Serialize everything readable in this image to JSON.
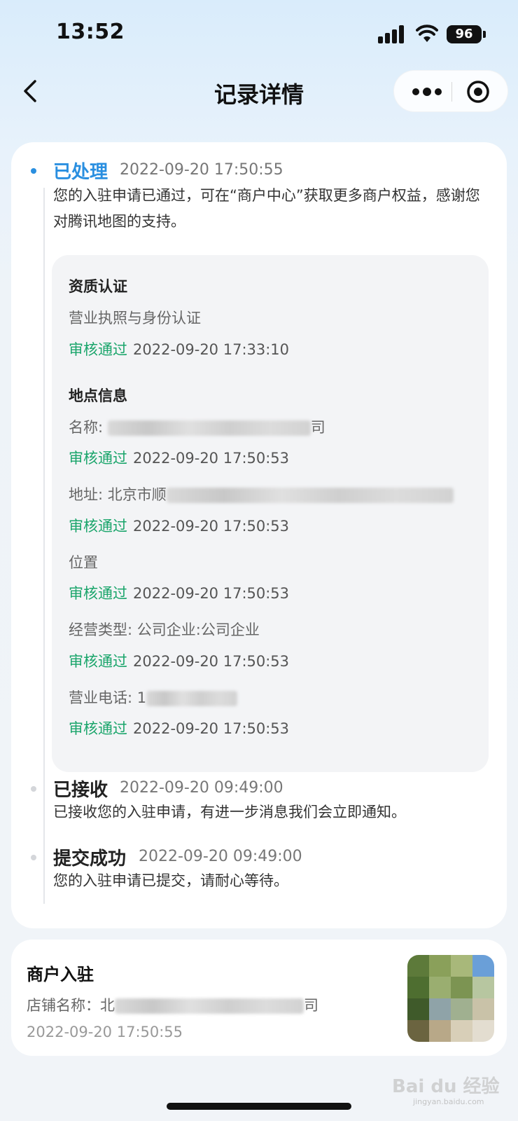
{
  "status_bar": {
    "time": "13:52",
    "battery": "96",
    "icons": [
      "signal-icon",
      "wifi-icon",
      "battery-icon"
    ]
  },
  "nav": {
    "title": "记录详情",
    "back_icon": "chevron-left-icon",
    "more_icon": "more-dots-icon",
    "close_icon": "target-close-icon"
  },
  "timeline": {
    "processed": {
      "status": "已处理",
      "time": "2022-09-20 17:50:55",
      "desc": "您的入驻申请已通过，可在“商户中心”获取更多商户权益，感谢您对腾讯地图的支持。",
      "color": "#2a8fe0"
    },
    "details": {
      "qualification_title": "资质认证",
      "qualification_item": "营业执照与身份认证",
      "qualification_result": "审核通过",
      "qualification_time": "2022-09-20 17:33:10",
      "location_title": "地点信息",
      "name_label": "名称: ",
      "name_tail": "司",
      "name_result": "审核通过",
      "name_time": "2022-09-20 17:50:53",
      "address_label": "地址: 北京市顺",
      "address_result": "审核通过",
      "address_time": "2022-09-20 17:50:53",
      "position_label": "位置",
      "position_result": "审核通过",
      "position_time": "2022-09-20 17:50:53",
      "biz_type_label": "经营类型: 公司企业:公司企业",
      "biz_type_result": "审核通过",
      "biz_type_time": "2022-09-20 17:50:53",
      "phone_label": "营业电话: 1",
      "phone_result": "审核通过",
      "phone_time": "2022-09-20 17:50:53",
      "approved_color": "#1aa56b"
    },
    "received": {
      "status": "已接收",
      "time": "2022-09-20 09:49:00",
      "desc": "已接收您的入驻申请，有进一步消息我们会立即通知。"
    },
    "submitted": {
      "status": "提交成功",
      "time": "2022-09-20 09:49:00",
      "desc": "您的入驻申请已提交，请耐心等待。"
    }
  },
  "merchant": {
    "title": "商户入驻",
    "store_label": "店铺名称：北",
    "store_tail": "司",
    "time": "2022-09-20 17:50:55"
  },
  "watermark": {
    "logo": "Bai du 经验",
    "sub": "jingyan.baidu.com"
  }
}
